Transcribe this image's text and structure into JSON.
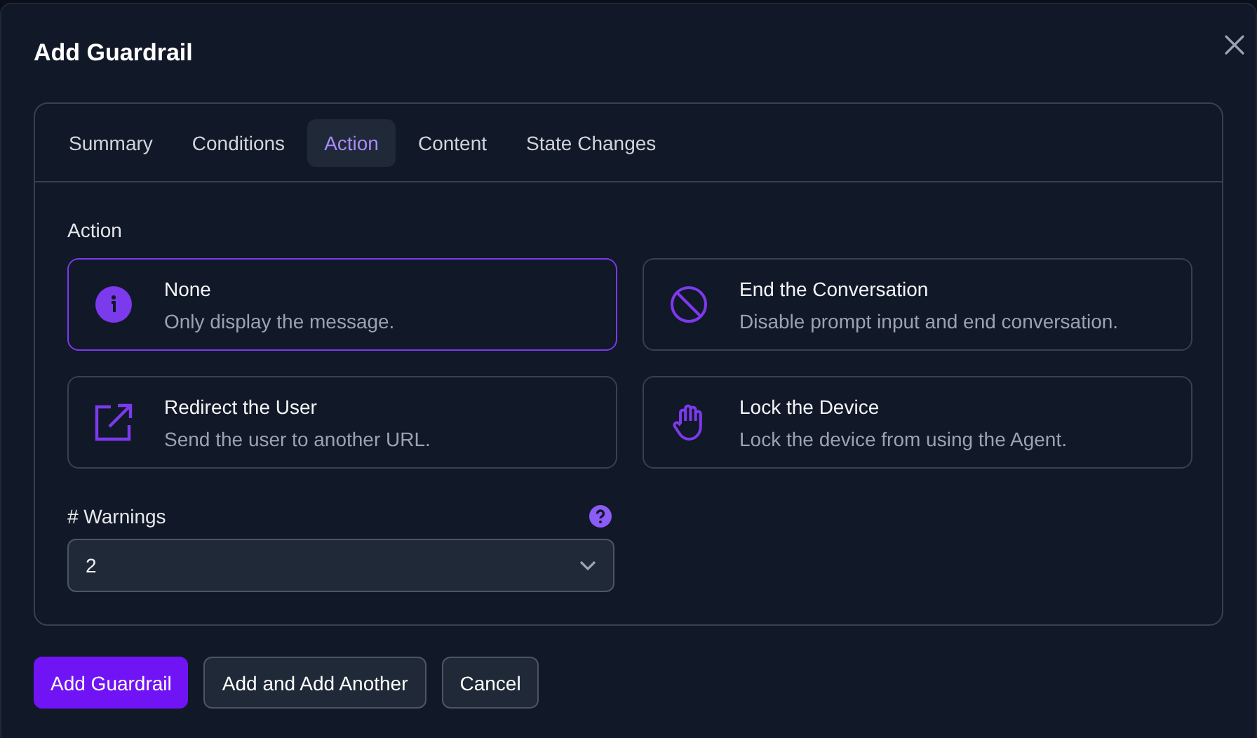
{
  "dialog": {
    "title": "Add Guardrail"
  },
  "tabs": [
    {
      "label": "Summary",
      "selected": false
    },
    {
      "label": "Conditions",
      "selected": false
    },
    {
      "label": "Action",
      "selected": true
    },
    {
      "label": "Content",
      "selected": false
    },
    {
      "label": "State Changes",
      "selected": false
    }
  ],
  "action": {
    "label": "Action",
    "options": [
      {
        "kind": "info",
        "title": "None",
        "description": "Only display the message.",
        "selected": true
      },
      {
        "kind": "block",
        "title": "End the Conversation",
        "description": "Disable prompt input and end conversation.",
        "selected": false
      },
      {
        "kind": "redirect",
        "title": "Redirect the User",
        "description": "Send the user to another URL.",
        "selected": false
      },
      {
        "kind": "hand",
        "title": "Lock the Device",
        "description": "Lock the device from using the Agent.",
        "selected": false
      }
    ]
  },
  "warnings": {
    "label": "# Warnings",
    "value": "2"
  },
  "buttons": [
    {
      "kind": "primary",
      "label": "Add Guardrail"
    },
    {
      "kind": "secondary",
      "label": "Add and Add Another"
    },
    {
      "kind": "secondary",
      "label": "Cancel"
    }
  ]
}
